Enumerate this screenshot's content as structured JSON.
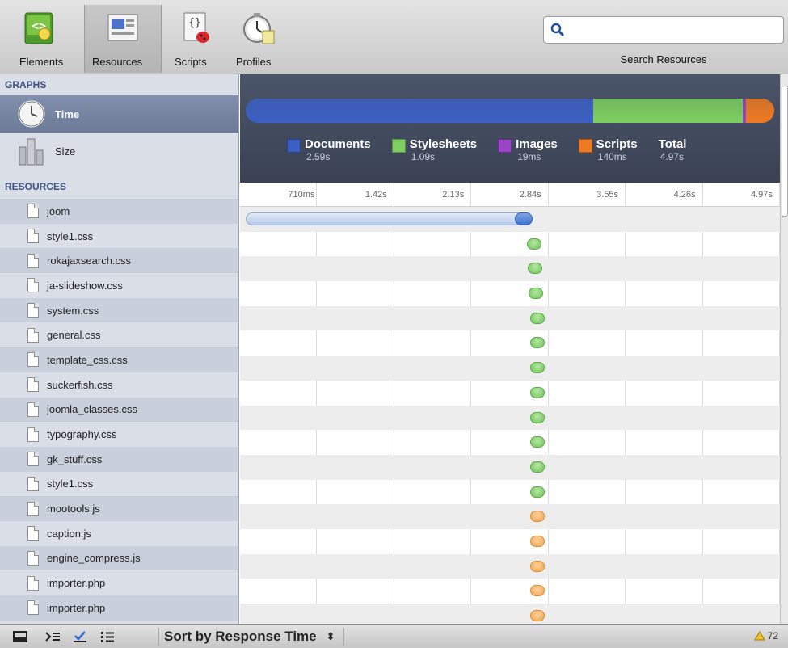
{
  "toolbar": {
    "buttons": [
      {
        "label": "Elements",
        "icon": "elements-icon"
      },
      {
        "label": "Resources",
        "icon": "resources-icon"
      },
      {
        "label": "Scripts",
        "icon": "scripts-icon"
      },
      {
        "label": "Profiles",
        "icon": "profiles-icon"
      }
    ],
    "search_placeholder": "",
    "search_label": "Search Resources"
  },
  "sidebar": {
    "graphs_header": "GRAPHS",
    "graphs": [
      {
        "label": "Time",
        "icon": "clock-icon"
      },
      {
        "label": "Size",
        "icon": "size-icon"
      }
    ],
    "resources_header": "RESOURCES",
    "resources": [
      {
        "name": "joom",
        "type": "document"
      },
      {
        "name": "style1.css",
        "type": "css"
      },
      {
        "name": "rokajaxsearch.css",
        "type": "css"
      },
      {
        "name": "ja-slideshow.css",
        "type": "css"
      },
      {
        "name": "system.css",
        "type": "css"
      },
      {
        "name": "general.css",
        "type": "css"
      },
      {
        "name": "template_css.css",
        "type": "css"
      },
      {
        "name": "suckerfish.css",
        "type": "css"
      },
      {
        "name": "joomla_classes.css",
        "type": "css"
      },
      {
        "name": "typography.css",
        "type": "css"
      },
      {
        "name": "gk_stuff.css",
        "type": "css"
      },
      {
        "name": "style1.css",
        "type": "css"
      },
      {
        "name": "mootools.js",
        "type": "js"
      },
      {
        "name": "caption.js",
        "type": "js"
      },
      {
        "name": "engine_compress.js",
        "type": "js"
      },
      {
        "name": "importer.php",
        "type": "js"
      },
      {
        "name": "importer.php",
        "type": "js"
      }
    ]
  },
  "summary": {
    "legend": [
      {
        "name": "Documents",
        "value": "2.59s",
        "color": "#3b5fc4"
      },
      {
        "name": "Stylesheets",
        "value": "1.09s",
        "color": "#7ed05e"
      },
      {
        "name": "Images",
        "value": "19ms",
        "color": "#9a44c8"
      },
      {
        "name": "Scripts",
        "value": "140ms",
        "color": "#f07a20"
      },
      {
        "name": "Total",
        "value": "4.97s",
        "color": ""
      }
    ],
    "bar_fractions": [
      0.657,
      0.283,
      0.006,
      0.054
    ]
  },
  "scale": {
    "ticks": [
      "710ms",
      "1.42s",
      "2.13s",
      "2.84s",
      "3.55s",
      "4.26s",
      "4.97s"
    ]
  },
  "timeline": {
    "total_seconds": 4.97,
    "document_bar": {
      "start": 0.0,
      "wait_end": 2.53,
      "end": 2.7
    },
    "blob_times": [
      2.71,
      2.72,
      2.73,
      2.74,
      2.74,
      2.74,
      2.74,
      2.74,
      2.74,
      2.74,
      2.74,
      2.74,
      2.74,
      2.74,
      2.74,
      2.74
    ]
  },
  "statusbar": {
    "sort_label": "Sort by Response Time",
    "warning_count": "72"
  }
}
